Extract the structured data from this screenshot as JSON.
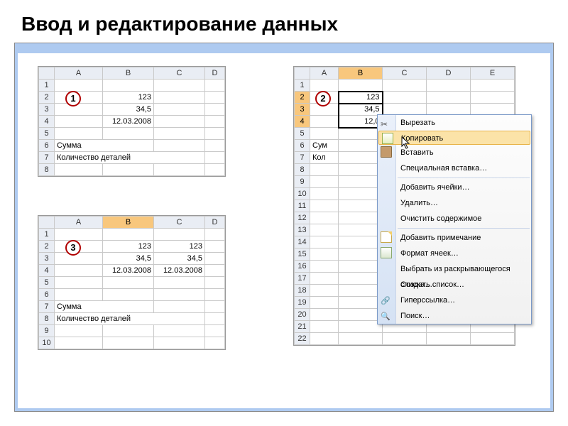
{
  "title": "Ввод и редактирование данных",
  "badges": {
    "b1": "1",
    "b2": "2",
    "b3": "3"
  },
  "headers": {
    "A": "A",
    "B": "B",
    "C": "C",
    "D": "D",
    "E": "E"
  },
  "rows": [
    "1",
    "2",
    "3",
    "4",
    "5",
    "6",
    "7",
    "8",
    "9",
    "10",
    "11",
    "12",
    "13",
    "14",
    "15",
    "16",
    "17",
    "18",
    "19",
    "20",
    "21",
    "22"
  ],
  "sheet1": {
    "b2": "123",
    "b3": "34,5",
    "b4": "12.03.2008",
    "a6": "Сумма",
    "a7": "Количество деталей"
  },
  "sheet2": {
    "b2": "123",
    "b3": "34,5",
    "b4": "12,0",
    "a6": "Сум",
    "a7": "Кол"
  },
  "sheet3": {
    "b2": "123",
    "c2": "123",
    "b3": "34,5",
    "c3": "34,5",
    "b4": "12.03.2008",
    "c4": "12.03.2008",
    "a7": "Сумма",
    "a8": "Количество деталей"
  },
  "menu": {
    "cut": "Вырезать",
    "copy": "Копировать",
    "paste": "Вставить",
    "paste_special": "Специальная вставка…",
    "insert_cells": "Добавить ячейки…",
    "delete": "Удалить…",
    "clear": "Очистить содержимое",
    "comment": "Добавить примечание",
    "format": "Формат ячеек…",
    "pick": "Выбрать из раскрывающегося списка…",
    "create_list": "Создать список…",
    "hyperlink": "Гиперссылка…",
    "find": "Поиск…"
  }
}
